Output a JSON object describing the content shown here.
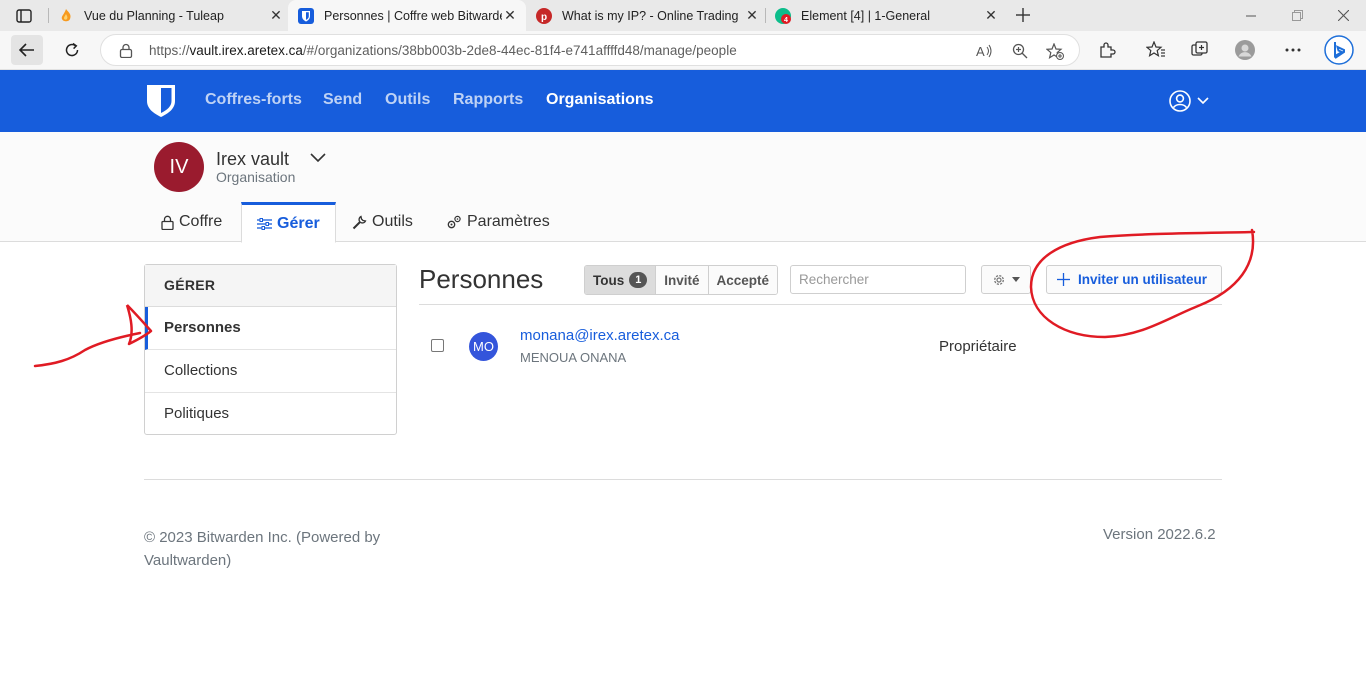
{
  "browser": {
    "tabs": [
      {
        "title": "Vue du Planning - Tuleap",
        "favicon": "tuleap-icon",
        "active": false
      },
      {
        "title": "Personnes | Coffre web Bitwarden",
        "favicon": "bitwarden-icon",
        "active": true
      },
      {
        "title": "What is my IP? - Online Trading",
        "favicon": "p-brand-icon",
        "active": false
      },
      {
        "title": "Element [4] | 1-General",
        "favicon": "element-icon",
        "active": false
      }
    ],
    "url_prefix": "https://",
    "url_host": "vault.irex.aretex.ca",
    "url_path": "/#/organizations/38bb003b-2de8-44ec-81f4-e741affffd48/manage/people",
    "colors": {
      "tabbar": "#e9e9e9",
      "toolbar": "#f7f7f7"
    }
  },
  "nav": {
    "links": [
      "Coffres-forts",
      "Send",
      "Outils",
      "Rapports",
      "Organisations"
    ],
    "active": "Organisations",
    "colors": {
      "background": "#175ddc",
      "brand": "#175ddc"
    }
  },
  "org": {
    "initials": "IV",
    "name": "Irex vault",
    "type": "Organisation",
    "avatar_color": "#9a1b2e",
    "tabs": [
      {
        "label": "Coffre",
        "icon": "lock-icon"
      },
      {
        "label": "Gérer",
        "icon": "sliders-icon",
        "active": true
      },
      {
        "label": "Outils",
        "icon": "wrench-icon"
      },
      {
        "label": "Paramètres",
        "icon": "gears-icon"
      }
    ]
  },
  "sidebar": {
    "heading": "GÉRER",
    "items": [
      {
        "label": "Personnes",
        "active": true
      },
      {
        "label": "Collections"
      },
      {
        "label": "Politiques"
      }
    ]
  },
  "main": {
    "title": "Personnes",
    "filters": [
      {
        "label": "Tous",
        "count": "1",
        "active": true
      },
      {
        "label": "Invité"
      },
      {
        "label": "Accepté"
      }
    ],
    "search_placeholder": "Rechercher",
    "invite_label": "Inviter un utilisateur",
    "users": [
      {
        "initials": "MO",
        "email": "monana@irex.aretex.ca",
        "name": "MENOUA ONANA",
        "role": "Propriétaire",
        "avatar_color": "#3455db"
      }
    ]
  },
  "footer": {
    "copyright": "© 2023 Bitwarden Inc. (Powered by Vaultwarden)",
    "version": "Version 2022.6.2"
  },
  "annotations": {
    "color": "#e01b24"
  }
}
